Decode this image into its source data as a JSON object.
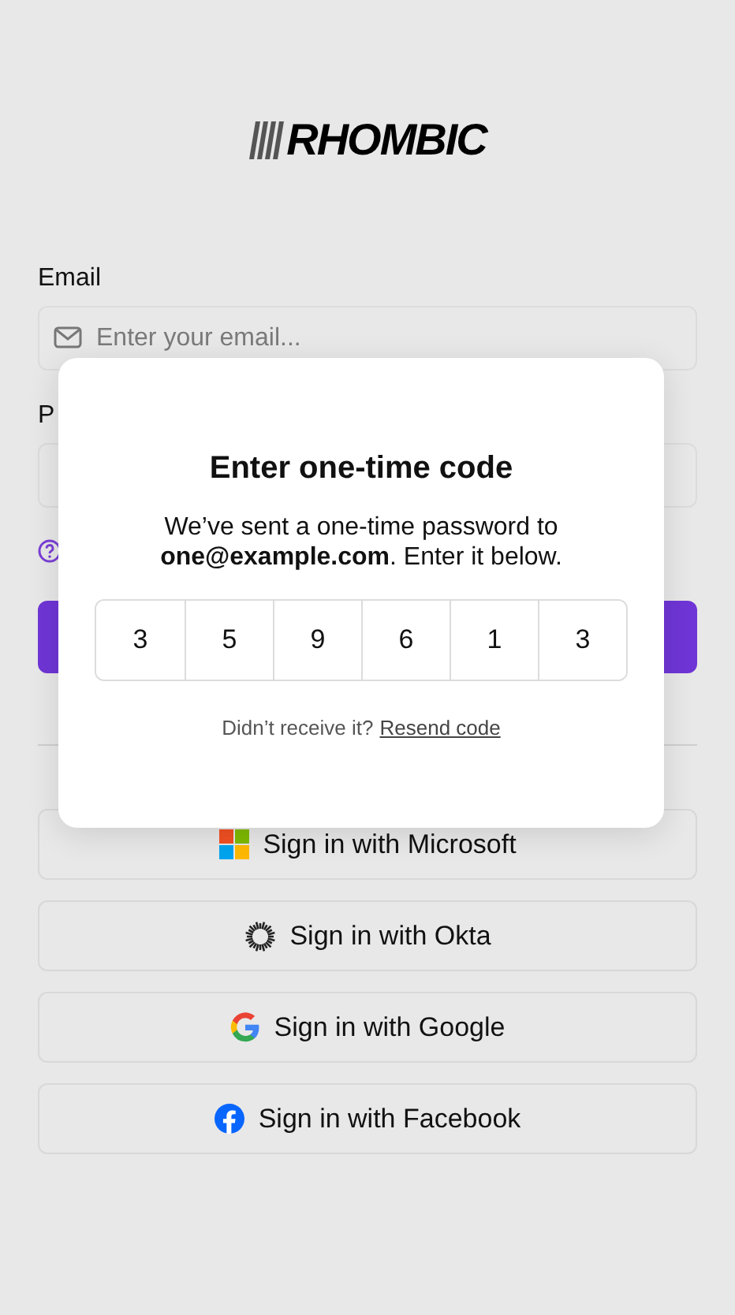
{
  "logo": {
    "text": "RHOMBIC"
  },
  "form": {
    "email_label": "Email",
    "email_placeholder": "Enter your email...",
    "password_label": "P"
  },
  "social_buttons": [
    {
      "kind": "microsoft",
      "label": "Sign in with Microsoft"
    },
    {
      "kind": "okta",
      "label": "Sign in with Okta"
    },
    {
      "kind": "google",
      "label": "Sign in with Google"
    },
    {
      "kind": "facebook",
      "label": "Sign in with Facebook"
    }
  ],
  "dialog": {
    "title": "Enter one-time code",
    "message": "We’ve sent a one-time password to **one@example.com**. Enter it below.",
    "code_digits": [
      "3",
      "5",
      "9",
      "6",
      "1",
      "3"
    ],
    "footer_text": "Didn’t receive it?",
    "resend_link": "Resend code"
  }
}
